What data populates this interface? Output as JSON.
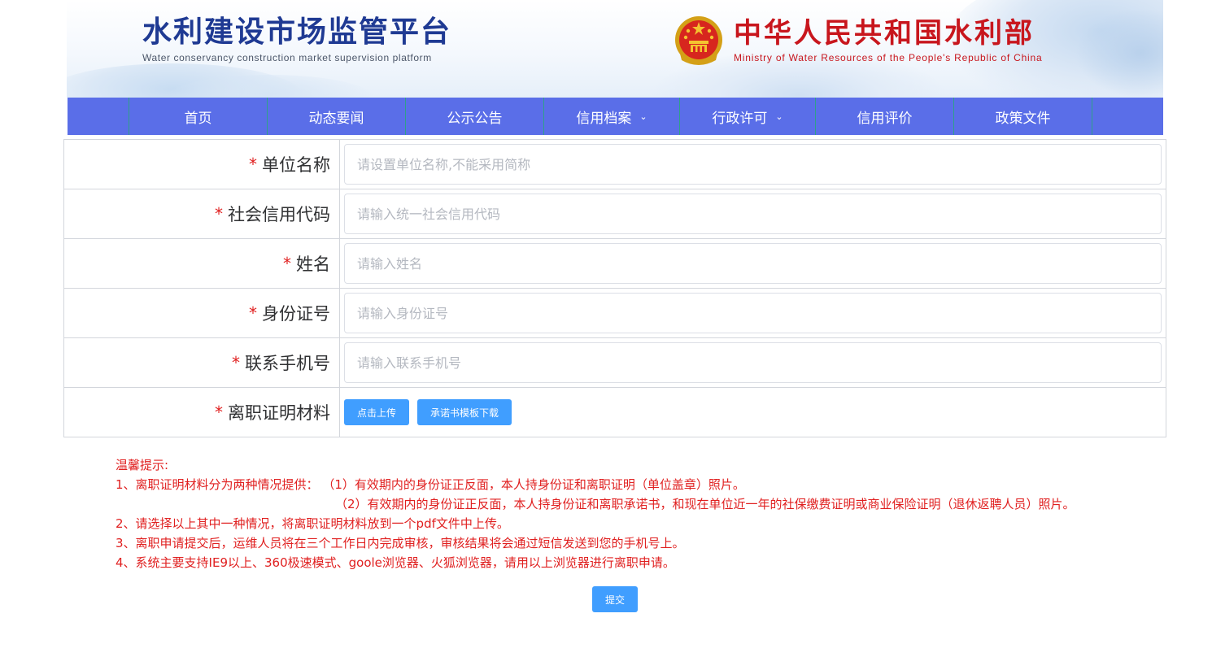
{
  "header": {
    "title": "水利建设市场监管平台",
    "subtitle": "Water conservancy construction market supervision platform",
    "ministry_title": "中华人民共和国水利部",
    "ministry_subtitle": "Ministry of Water Resources of the People's Republic of China"
  },
  "nav": {
    "items": [
      {
        "label": "首页",
        "dropdown": false
      },
      {
        "label": "动态要闻",
        "dropdown": false
      },
      {
        "label": "公示公告",
        "dropdown": false
      },
      {
        "label": "信用档案",
        "dropdown": true,
        "icon": "chevron-down-icon"
      },
      {
        "label": "行政许可",
        "dropdown": true,
        "icon": "chevron-down-icon"
      },
      {
        "label": "信用评价",
        "dropdown": false
      },
      {
        "label": "政策文件",
        "dropdown": false
      }
    ]
  },
  "form": {
    "required_mark": "*",
    "fields": [
      {
        "label": "单位名称",
        "placeholder": "请设置单位名称,不能采用简称",
        "value": ""
      },
      {
        "label": "社会信用代码",
        "placeholder": "请输入统一社会信用代码",
        "value": ""
      },
      {
        "label": "姓名",
        "placeholder": "请输入姓名",
        "value": ""
      },
      {
        "label": "身份证号",
        "placeholder": "请输入身份证号",
        "value": ""
      },
      {
        "label": "联系手机号",
        "placeholder": "请输入联系手机号",
        "value": ""
      }
    ],
    "upload": {
      "label": "离职证明材料",
      "upload_button": "点击上传",
      "template_button": "承诺书模板下载"
    }
  },
  "tips": {
    "title": "温馨提示:",
    "line1": "1、离职证明材料分为两种情况提供： （1）有效期内的身份证正反面，本人持身份证和离职证明（单位盖章）照片。",
    "line1b": "（2）有效期内的身份证正反面，本人持身份证和离职承诺书，和现在单位近一年的社保缴费证明或商业保险证明（退休返聘人员）照片。",
    "line2": "2、请选择以上其中一种情况，将离职证明材料放到一个pdf文件中上传。",
    "line3": "3、离职申请提交后，运维人员将在三个工作日内完成审核，审核结果将会通过短信发送到您的手机号上。",
    "line4": "4、系统主要支持IE9以上、360极速模式、goole浏览器、火狐浏览器，请用以上浏览器进行离职申请。"
  },
  "submit_label": "提交",
  "colors": {
    "nav_bg": "#5a6ee8",
    "nav_divider": "#2fa08a",
    "brand_blue": "#1f3a93",
    "ministry_red": "#c8161d",
    "required_red": "#e02020",
    "button_blue": "#409eff"
  }
}
